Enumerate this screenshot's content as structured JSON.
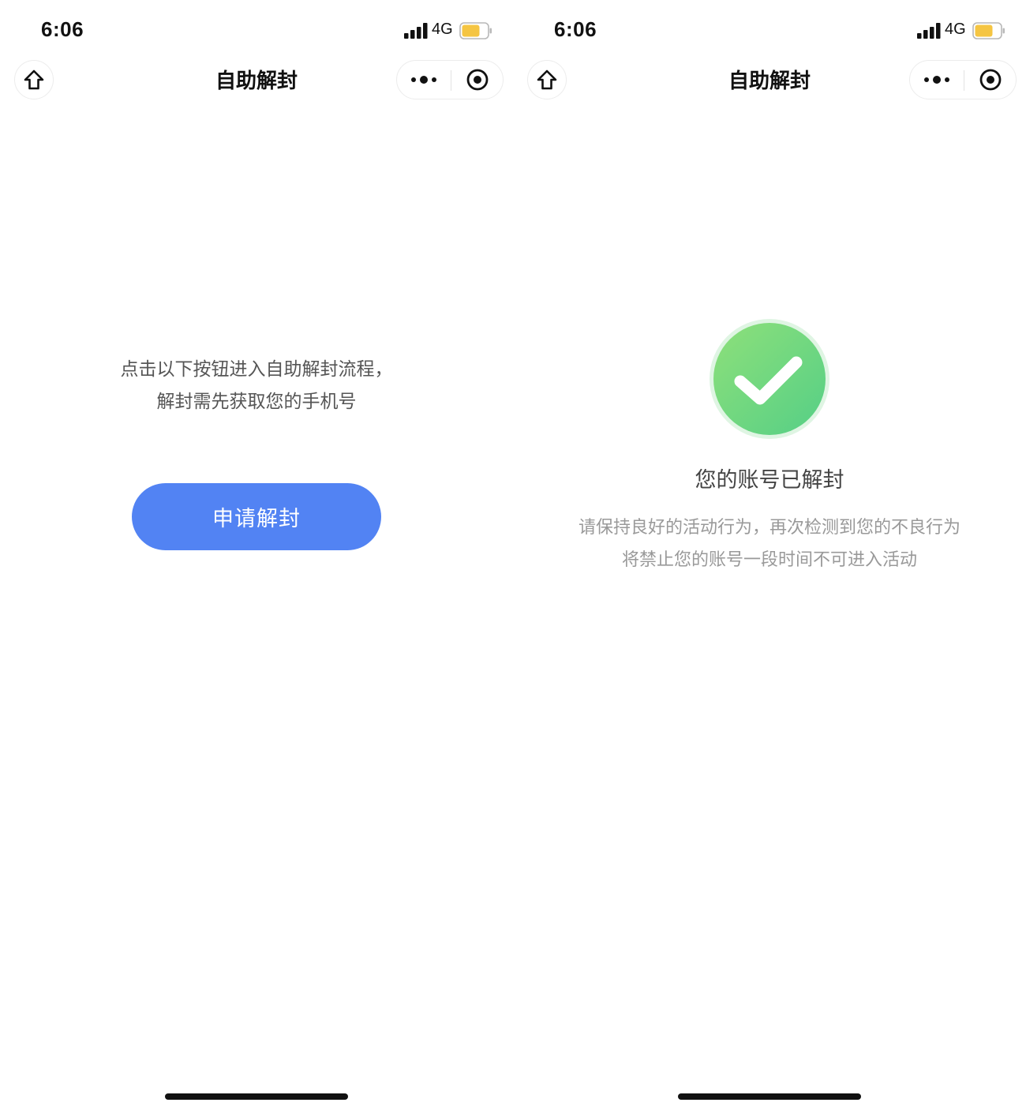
{
  "screens": [
    {
      "status_bar": {
        "time": "6:06",
        "network": "4G"
      },
      "nav": {
        "title": "自助解封"
      },
      "content": {
        "intro_line1": "点击以下按钮进入自助解封流程，",
        "intro_line2": "解封需先获取您的手机号",
        "button_label": "申请解封"
      }
    },
    {
      "status_bar": {
        "time": "6:06",
        "network": "4G"
      },
      "nav": {
        "title": "自助解封"
      },
      "content": {
        "success_title": "您的账号已解封",
        "desc_line1": "请保持良好的活动行为，再次检测到您的不良行为",
        "desc_line2": "将禁止您的账号一段时间不可进入活动"
      }
    }
  ],
  "icons": {
    "home": "home-icon",
    "more": "more-dots-icon",
    "close": "target-circle-icon",
    "success": "check-circle-icon"
  },
  "colors": {
    "primary_button": "#5283f3",
    "success_green": "#5dd47f",
    "battery_fill": "#f5c542"
  }
}
